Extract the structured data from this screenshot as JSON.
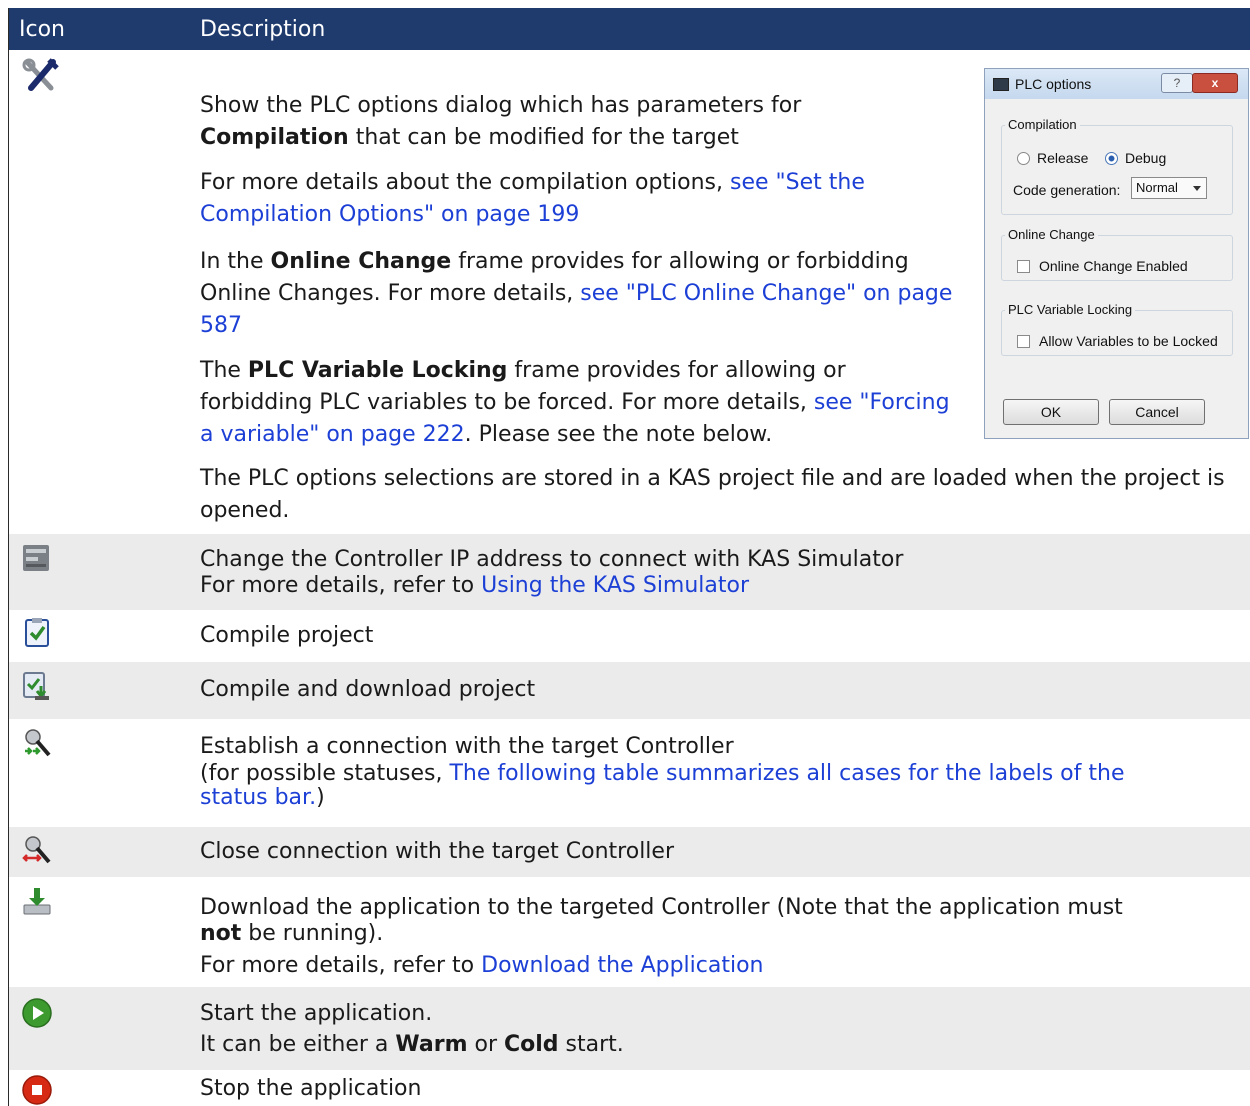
{
  "header": {
    "icon_col": "Icon",
    "desc_col": "Description"
  },
  "colors": {
    "header_bg": "#1f3b6e",
    "link": "#1c3fd6",
    "row_alt": "#ebebeb"
  },
  "row1": {
    "icon": "tools-icon",
    "p1a": "Show the PLC options dialog which has parameters for",
    "p1b_bold": "Compilation",
    "p1b": " that can be modified for the target",
    "p2a": "For more details about the compilation options, ",
    "p2_link": "see \"Set the Compilation Options\" on page 199",
    "p3a": "In the ",
    "p3_bold": "Online Change",
    "p3b": " frame provides for allowing or forbidding Online Changes. For more details, ",
    "p3_link": "see \"PLC Online Change\" on page 587",
    "p4a": "The ",
    "p4_bold": "PLC Variable Locking",
    "p4b": " frame provides for allowing or forbidding PLC variables to be forced. For more details, ",
    "p4_link": "see \"Forcing a variable\" on page 222",
    "p4c": ". Please see the note below.",
    "p5": "The PLC options selections are stored in a KAS project file and are loaded when the project is opened."
  },
  "dialog": {
    "title": "PLC options",
    "compilation_label": "Compilation",
    "release_label": "Release",
    "debug_label": "Debug",
    "selected_mode": "Debug",
    "codegen_label": "Code generation:",
    "codegen_value": "Normal",
    "online_change_label": "Online Change",
    "online_change_enabled_label": "Online Change Enabled",
    "online_change_enabled": false,
    "locking_label": "PLC Variable Locking",
    "allow_locked_label": "Allow Variables to be Locked",
    "allow_locked": false,
    "ok_label": "OK",
    "cancel_label": "Cancel",
    "help_glyph": "?",
    "close_glyph": "x"
  },
  "row2": {
    "icon": "simulator-icon",
    "line1": "Change the Controller IP address to connect with KAS Simulator",
    "line2a": "For more details, refer to ",
    "line2_link": "Using the KAS Simulator"
  },
  "row3": {
    "icon": "compile-icon",
    "text": "Compile project"
  },
  "row4": {
    "icon": "compile-download-icon",
    "text": "Compile and download project"
  },
  "row5": {
    "icon": "connect-icon",
    "line1": "Establish a connection with the target Controller",
    "line2a": "(for possible statuses, ",
    "line2_link_a": "The following table summarizes all cases for the labels of the",
    "line3_link": "status bar.",
    "line3b": ")"
  },
  "row6": {
    "icon": "disconnect-icon",
    "text": "Close connection with the target Controller"
  },
  "row7": {
    "icon": "download-icon",
    "line1": "Download the application to the targeted Controller (Note that the application must",
    "line2_bold": "not",
    "line2b": " be running).",
    "line3a": "For more details, refer to ",
    "line3_link": "Download the Application"
  },
  "row8": {
    "icon": "start-icon",
    "line1": "Start the application.",
    "line2a": "It can be either a ",
    "line2_bold1": "Warm",
    "line2b": " or ",
    "line2_bold2": "Cold",
    "line2c": " start."
  },
  "row9": {
    "icon": "stop-icon",
    "text": "Stop the application"
  }
}
